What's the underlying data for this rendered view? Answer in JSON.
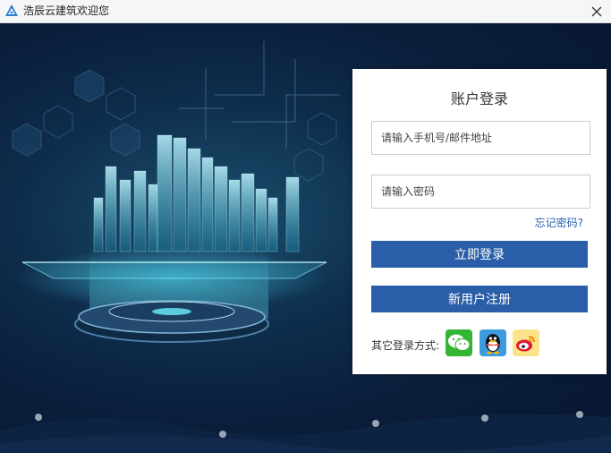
{
  "window": {
    "title": "浩辰云建筑欢迎您",
    "logo_icon": "triangle-logo-icon",
    "close_icon": "close-icon"
  },
  "login": {
    "title": "账户登录",
    "account_placeholder": "请输入手机号/邮件地址",
    "account_value": "",
    "password_placeholder": "请输入密码",
    "password_value": "",
    "forgot_label": "忘记密码?",
    "login_button": "立即登录",
    "register_button": "新用户注册",
    "other_label": "其它登录方式:",
    "social": [
      {
        "name": "wechat",
        "icon": "wechat-icon",
        "color": "#35b534"
      },
      {
        "name": "qq",
        "icon": "qq-penguin-icon",
        "color": "#3c9bdc"
      },
      {
        "name": "weibo",
        "icon": "weibo-icon",
        "color": "#fbe38a"
      }
    ]
  },
  "colors": {
    "primary": "#2a5ea8",
    "link": "#2a62b0",
    "background": "#0b1a33"
  }
}
